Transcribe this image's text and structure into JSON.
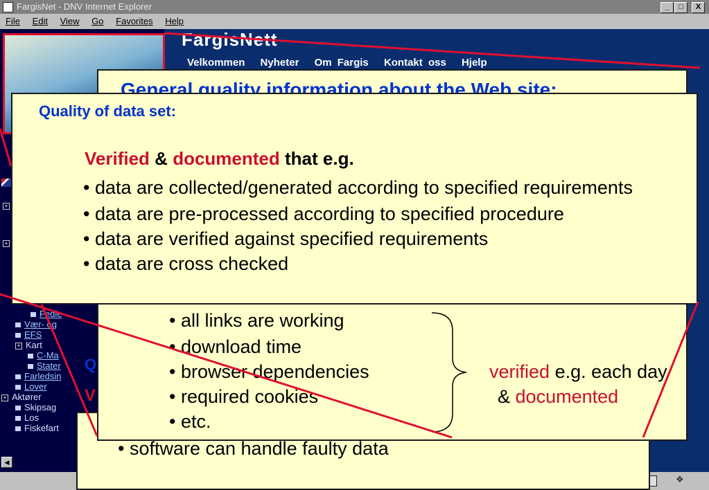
{
  "window": {
    "title": "FargisNet - DNV Internet Explorer",
    "buttons": [
      "_",
      "□",
      "X"
    ]
  },
  "menu": [
    "File",
    "Edit",
    "View",
    "Go",
    "Favorites",
    "Help"
  ],
  "site": {
    "title": "FargisNett",
    "nav": [
      "Velkommen",
      "Nyheter",
      "Om Fargis",
      "Kontakt oss",
      "Hjelp"
    ]
  },
  "sidebar": {
    "items": [
      {
        "label": "Fedie",
        "kind": "link-sub"
      },
      {
        "label": "Vær- og",
        "kind": "link"
      },
      {
        "label": "EFS",
        "kind": "link"
      },
      {
        "label": "Kart",
        "kind": "group"
      },
      {
        "label": "C-Ma",
        "kind": "link-sub"
      },
      {
        "label": "Stater",
        "kind": "link-sub"
      },
      {
        "label": "Farledsin",
        "kind": "link"
      },
      {
        "label": "Lover",
        "kind": "link"
      },
      {
        "label": "Aktører",
        "kind": "group-top"
      },
      {
        "label": "Skipsag",
        "kind": "item"
      },
      {
        "label": "Los",
        "kind": "item"
      },
      {
        "label": "Fiskefart",
        "kind": "item"
      }
    ]
  },
  "slide": {
    "back_box": {
      "heading": "General quality information about the Web site:",
      "bullets": [
        "all links are working",
        "download time",
        "browser dependencies",
        "required cookies",
        "etc."
      ],
      "side_q": "Q",
      "side_v": "V",
      "verified": "verified",
      "verified_rest": "e.g. each day",
      "amp": "&",
      "documented": "documented"
    },
    "bottom_box": {
      "bullet": "software can handle faulty data"
    },
    "front_box": {
      "heading": "Quality of data set:",
      "verified": "Verified",
      "amp": "&",
      "documented": "documented",
      "that": "that e.g.",
      "bullets": [
        "data are collected/generated according to specified requirements",
        "data are pre-processed according to specified procedure",
        "data are verified against specified requirements",
        "data are cross checked"
      ]
    }
  }
}
